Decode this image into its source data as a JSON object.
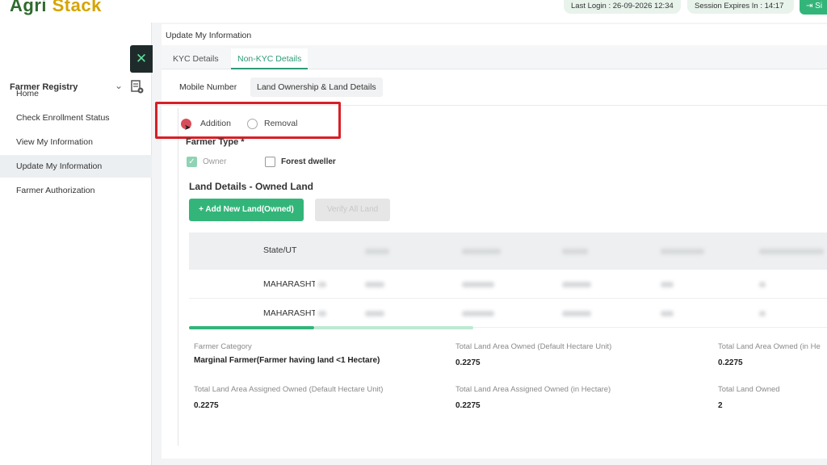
{
  "header": {
    "logo_agri": "Agri",
    "logo_stack": "Stack",
    "last_login": "Last Login : 26-09-2026 12:34",
    "session": "Session Expires In : 14:17",
    "signout_label": "Si"
  },
  "sidebar": {
    "close_glyph": "✕",
    "registry_title": "Farmer Registry",
    "items": [
      {
        "label": "Home"
      },
      {
        "label": "Check Enrollment Status"
      },
      {
        "label": "View My Information"
      },
      {
        "label": "Update My Information"
      },
      {
        "label": "Farmer Authorization"
      }
    ]
  },
  "main": {
    "page_title": "Update My Information",
    "tabs": [
      {
        "label": "KYC Details"
      },
      {
        "label": "Non-KYC Details"
      }
    ],
    "subtabs": [
      {
        "label": "Mobile Number"
      },
      {
        "label": "Land Ownership & Land Details"
      }
    ],
    "radio": {
      "addition": "Addition",
      "removal": "Removal"
    },
    "farmer_type": {
      "title": "Farmer Type *",
      "owner": "Owner",
      "forest": "Forest dweller"
    },
    "land_section_title": "Land Details - Owned Land",
    "add_button": "+ Add New Land(Owned)",
    "verify_button": "Verify All Land",
    "table": {
      "header_state": "State/UT",
      "rows": [
        {
          "state": "MAHARASHTRA"
        },
        {
          "state": "MAHARASHTRA"
        }
      ]
    },
    "summary": {
      "farmer_category_label": "Farmer Category",
      "farmer_category_value": "Marginal  Farmer(Farmer having land <1 Hectare)",
      "total_area_default_label": "Total Land Area Owned (Default Hectare Unit)",
      "total_area_default_value": "0.2275",
      "total_area_hectare_label": "Total Land Area Owned (in He",
      "total_area_hectare_value": "0.2275",
      "assigned_default_label": "Total Land Area Assigned Owned (Default Hectare Unit)",
      "assigned_default_value": "0.2275",
      "assigned_hectare_label": "Total Land Area Assigned Owned (in Hectare)",
      "assigned_hectare_value": "0.2275",
      "total_land_owned_label": "Total Land Owned",
      "total_land_owned_value": "2"
    }
  }
}
